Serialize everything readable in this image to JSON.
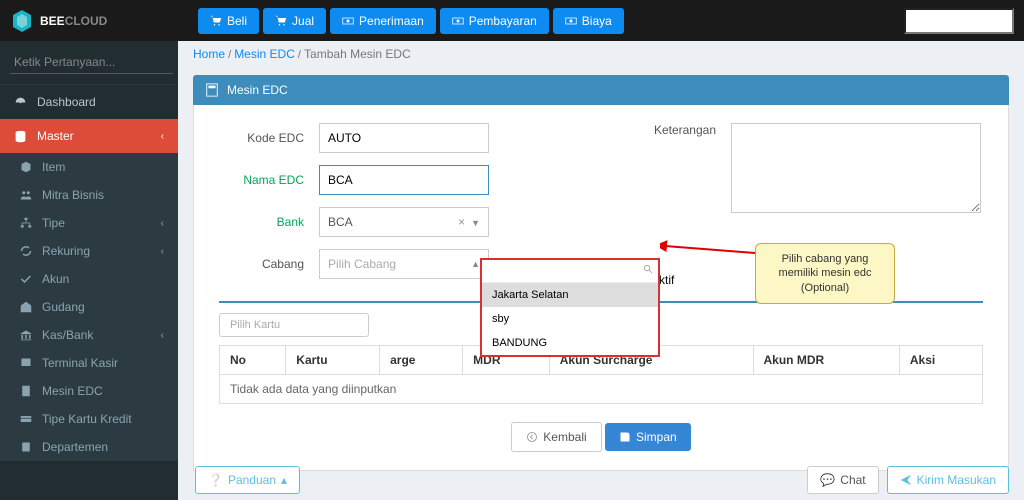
{
  "brand": {
    "part1": "BEE",
    "part2": "CLOUD"
  },
  "nav": {
    "beli": "Beli",
    "jual": "Jual",
    "penerimaan": "Penerimaan",
    "pembayaran": "Pembayaran",
    "biaya": "Biaya"
  },
  "breadcrumb": {
    "home": "Home",
    "l1": "Mesin EDC",
    "l2": "Tambah Mesin EDC"
  },
  "search": {
    "placeholder": "Ketik Pertanyaan..."
  },
  "side": {
    "dashboard": "Dashboard",
    "master": "Master",
    "sub": {
      "item": "Item",
      "mitra": "Mitra Bisnis",
      "tipe": "Tipe",
      "rekuring": "Rekuring",
      "akun": "Akun",
      "gudang": "Gudang",
      "kasbank": "Kas/Bank",
      "terminal": "Terminal Kasir",
      "mesin": "Mesin EDC",
      "kartu": "Tipe Kartu Kredit",
      "dept": "Departemen"
    }
  },
  "panel": {
    "title": "Mesin EDC"
  },
  "form": {
    "kode_lbl": "Kode EDC",
    "kode_val": "AUTO",
    "nama_lbl": "Nama EDC",
    "nama_val": "BCA",
    "bank_lbl": "Bank",
    "bank_val": "BCA",
    "cabang_lbl": "Cabang",
    "cabang_ph": "Pilih Cabang",
    "ket_lbl": "Keterangan",
    "aktif_lbl": "Aktif",
    "kartu_ph": "Pilih Kartu"
  },
  "dropdown": {
    "opt1": "Jakarta Selatan",
    "opt2": "sby",
    "opt3": "BANDUNG"
  },
  "callout": {
    "text": "Pilih cabang yang memiliki mesin edc (Optional)"
  },
  "table": {
    "th": {
      "no": "No",
      "kartu": "Kartu",
      "charge": "arge",
      "mdr": "MDR",
      "akun_s": "Akun Surcharge",
      "akun_m": "Akun MDR",
      "aksi": "Aksi"
    },
    "empty": "Tidak ada data yang diinputkan"
  },
  "buttons": {
    "kembali": "Kembali",
    "simpan": "Simpan",
    "panduan": "Panduan",
    "chat": "Chat",
    "kirim": "Kirim Masukan"
  }
}
